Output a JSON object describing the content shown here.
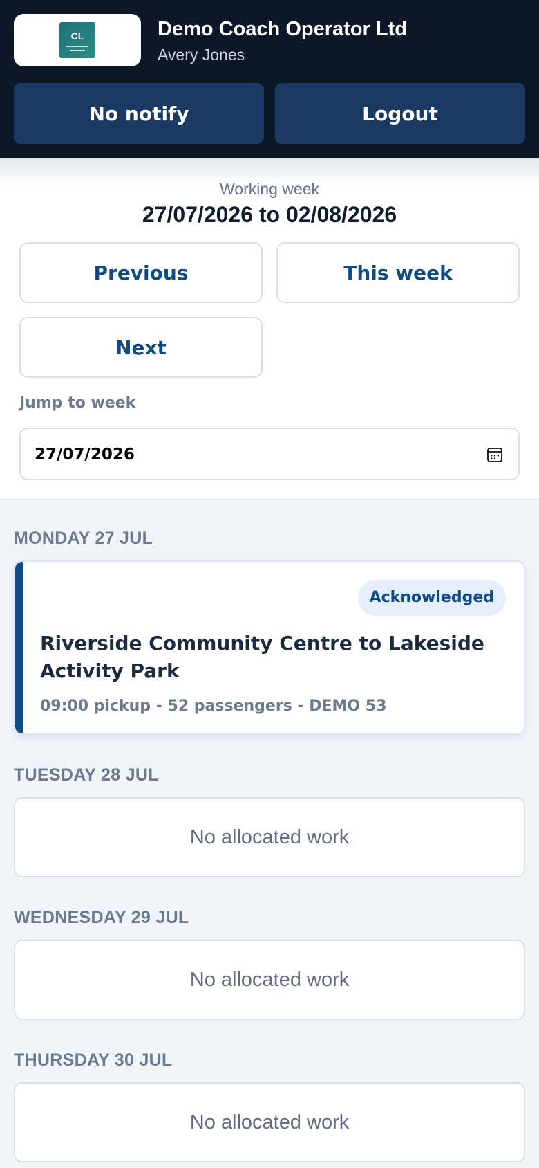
{
  "header": {
    "logo_text": "CL",
    "org_name": "Demo Coach Operator Ltd",
    "user_name": "Avery Jones",
    "notify_label": "No notify",
    "logout_label": "Logout"
  },
  "week": {
    "label": "Working week",
    "range": "27/07/2026 to 02/08/2026",
    "prev_label": "Previous",
    "this_label": "This week",
    "next_label": "Next",
    "jump_label": "Jump to week",
    "jump_value": "27/07/2026",
    "calendar_icon": "calendar-icon"
  },
  "days": [
    {
      "heading": "MONDAY 27 JUL",
      "job": {
        "status": "Acknowledged",
        "title": "Riverside Community Centre to Lakeside Activity Park",
        "meta": "09:00 pickup - 52 passengers - DEMO 53"
      }
    },
    {
      "heading": "TUESDAY 28 JUL",
      "empty": "No allocated work"
    },
    {
      "heading": "WEDNESDAY 29 JUL",
      "empty": "No allocated work"
    },
    {
      "heading": "THURSDAY 30 JUL",
      "empty": "No allocated work"
    }
  ],
  "colors": {
    "header_bg": "#0c1728",
    "header_button": "#1b3a63",
    "accent": "#0e4a86",
    "badge_bg": "#e4effb",
    "page_bg": "#f1f5fa"
  }
}
